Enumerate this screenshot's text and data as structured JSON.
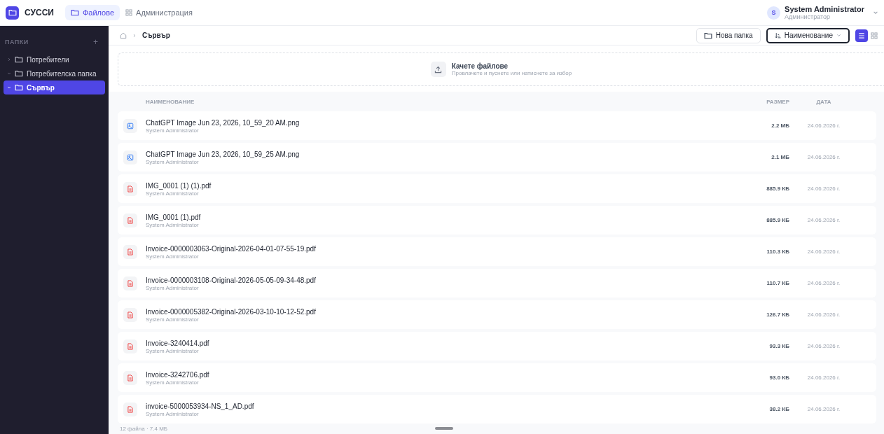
{
  "app": {
    "name": "СУССИ"
  },
  "nav": [
    {
      "label": "Файлове",
      "kind": "folder",
      "selected": true
    },
    {
      "label": "Администрация",
      "kind": "grid",
      "selected": false
    }
  ],
  "user": {
    "initial": "S",
    "name": "System Administrator",
    "role": "Администратор"
  },
  "sidebar": {
    "title": "ПАПКИ",
    "add": "+",
    "items": [
      {
        "label": "Потребители",
        "expanded": false,
        "selected": false
      },
      {
        "label": "Потребителска папка",
        "expanded": true,
        "selected": false
      },
      {
        "label": "Сървър",
        "expanded": true,
        "selected": true
      }
    ]
  },
  "breadcrumb": {
    "current": "Сървър"
  },
  "toolbar": {
    "new_folder": "Нова папка",
    "sort": "Наименование",
    "views": [
      {
        "kind": "list",
        "selected": true
      },
      {
        "kind": "grid",
        "selected": false
      }
    ]
  },
  "upload": {
    "title": "Качете файлове",
    "hint": "Провлачете и пуснете или натиснете за избор"
  },
  "table": {
    "columns": [
      "НАИМЕНОВАНИЕ",
      "РАЗМЕР",
      "ДАТА"
    ],
    "rows": [
      {
        "kind": "image",
        "name": "ChatGPT Image Jun 23, 2026, 10_59_20 AM.png",
        "owner": "System Administrator",
        "size": "2.2 МБ",
        "date": "24.06.2026 г."
      },
      {
        "kind": "image",
        "name": "ChatGPT Image Jun 23, 2026, 10_59_25 AM.png",
        "owner": "System Administrator",
        "size": "2.1 МБ",
        "date": "24.06.2026 г."
      },
      {
        "kind": "pdf",
        "name": "IMG_0001 (1) (1).pdf",
        "owner": "System Administrator",
        "size": "885.9 КБ",
        "date": "24.06.2026 г."
      },
      {
        "kind": "pdf",
        "name": "IMG_0001 (1).pdf",
        "owner": "System Administrator",
        "size": "885.9 КБ",
        "date": "24.06.2026 г."
      },
      {
        "kind": "pdf",
        "name": "Invoice-0000003063-Original-2026-04-01-07-55-19.pdf",
        "owner": "System Administrator",
        "size": "110.3 КБ",
        "date": "24.06.2026 г."
      },
      {
        "kind": "pdf",
        "name": "Invoice-0000003108-Original-2026-05-05-09-34-48.pdf",
        "owner": "System Administrator",
        "size": "110.7 КБ",
        "date": "24.06.2026 г."
      },
      {
        "kind": "pdf",
        "name": "Invoice-0000005382-Original-2026-03-10-10-12-52.pdf",
        "owner": "System Administrator",
        "size": "126.7 КБ",
        "date": "24.06.2026 г."
      },
      {
        "kind": "pdf",
        "name": "Invoice-3240414.pdf",
        "owner": "System Administrator",
        "size": "93.3 КБ",
        "date": "24.06.2026 г."
      },
      {
        "kind": "pdf",
        "name": "Invoice-3242706.pdf",
        "owner": "System Administrator",
        "size": "93.0 КБ",
        "date": "24.06.2026 г."
      },
      {
        "kind": "pdf",
        "name": "invoice-5000053934-NS_1_AD.pdf",
        "owner": "System Administrator",
        "size": "38.2 КБ",
        "date": "24.06.2026 г."
      }
    ]
  },
  "status_bar": {
    "summary": "12 файла · 7.4 МБ"
  }
}
